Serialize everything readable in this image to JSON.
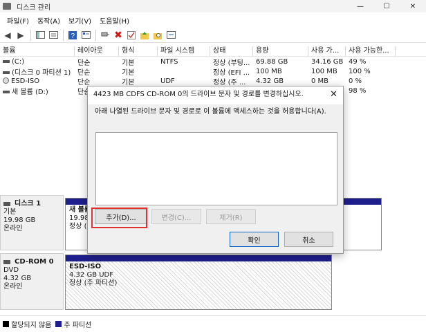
{
  "window": {
    "title": "디스크 관리"
  },
  "menu": [
    "파일(F)",
    "동작(A)",
    "보기(V)",
    "도움말(H)"
  ],
  "volume_table": {
    "columns": [
      "볼륨",
      "레이아웃",
      "형식",
      "파일 시스템",
      "상태",
      "용량",
      "사용 가...",
      "사용 가능한..."
    ],
    "rows": [
      [
        "(C:)",
        "단순",
        "기본",
        "NTFS",
        "정상 (부팅...",
        "69.88 GB",
        "34.16 GB",
        "49 %"
      ],
      [
        "(디스크 0 파티션 1)",
        "단순",
        "기본",
        "",
        "정상 (EFI ...",
        "100 MB",
        "100 MB",
        "100 %"
      ],
      [
        "ESD-ISO",
        "단순",
        "기본",
        "UDF",
        "정상 (주 ...",
        "4.32 GB",
        "0 MB",
        "0 %"
      ],
      [
        "새 볼륨 (D:)",
        "단순",
        "",
        "",
        "",
        "",
        "",
        "98 %"
      ]
    ]
  },
  "disks": [
    {
      "name": "디스크 1",
      "type": "기본",
      "size": "19.98 GB",
      "status": "온라인",
      "partition": {
        "name": "새 볼륨",
        "size": "19.98",
        "status": "정상 ("
      }
    },
    {
      "name": "CD-ROM 0",
      "type": "DVD",
      "size": "4.32 GB",
      "status": "온라인",
      "partition": {
        "name": "ESD-ISO",
        "size": "4.32 GB UDF",
        "status": "정상 (주 파티션)"
      }
    }
  ],
  "legend": [
    {
      "label": "할당되지 않음",
      "color": "#000000"
    },
    {
      "label": "주 파티션",
      "color": "#1e1e8c"
    }
  ],
  "dialog": {
    "title": "4423 MB CDFS  CD-ROM 0의 드라이브 문자 및 경로를 변경하십시오.",
    "description": "아래 나열된 드라이브 문자 및 경로로 이 볼륨에 액세스하는 것을 허용합니다(A).",
    "add_label": "추가(D)...",
    "change_label": "변경(C)...",
    "remove_label": "제거(R)",
    "ok_label": "확인",
    "cancel_label": "취소"
  }
}
